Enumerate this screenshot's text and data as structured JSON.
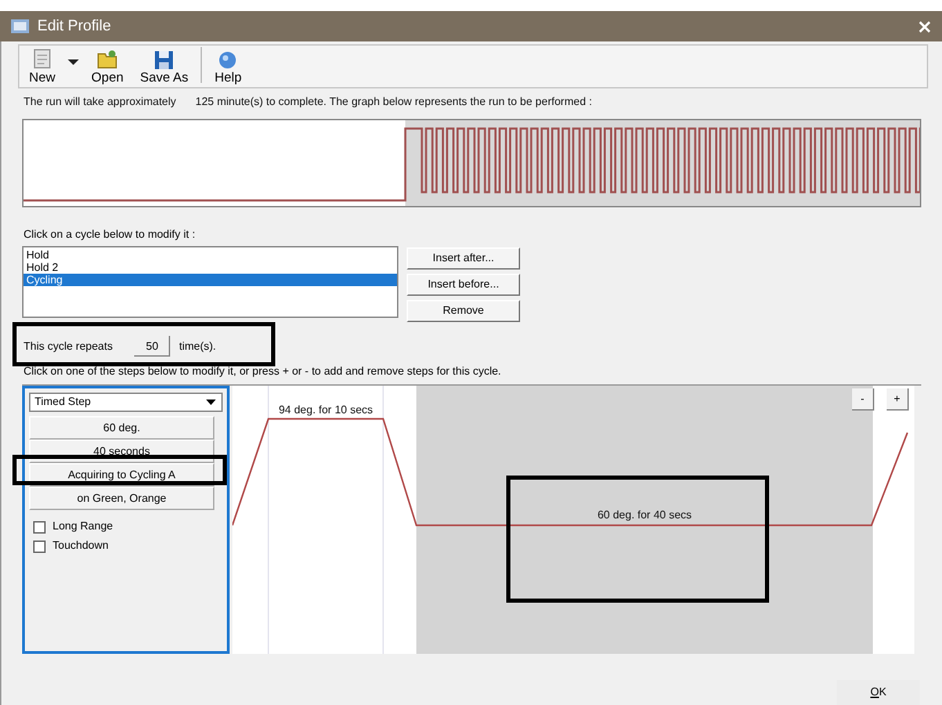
{
  "window": {
    "title": "Edit Profile"
  },
  "toolbar": [
    {
      "kind": "new",
      "label": "New"
    },
    {
      "kind": "dropdown"
    },
    {
      "kind": "open",
      "label": "Open"
    },
    {
      "kind": "save",
      "label": "Save As"
    },
    {
      "kind": "separator"
    },
    {
      "kind": "help",
      "label": "Help"
    }
  ],
  "run_info": {
    "prefix": "The run will take approximately",
    "duration": "125 minute(s) to complete. The graph below represents the run to be performed :"
  },
  "cycles_label": "Click on a cycle below to modify it :",
  "cycles": [
    {
      "label": "Hold",
      "selected": false
    },
    {
      "label": "Hold 2",
      "selected": false
    },
    {
      "label": "Cycling",
      "selected": true
    }
  ],
  "cycle_buttons": [
    "Insert after...",
    "Insert before...",
    "Remove"
  ],
  "repeat": {
    "label": "This cycle repeats",
    "value": "50",
    "unit": "time(s)."
  },
  "steps_label": "Click on one of the steps below to modify it, or press + or - to add and remove steps for this cycle.",
  "step_editor": {
    "type": "Timed Step",
    "buttons": [
      "60 deg.",
      "40 seconds",
      "Acquiring to Cycling A",
      "on Green, Orange"
    ],
    "options": [
      {
        "label": "Long Range",
        "checked": false
      },
      {
        "label": "Touchdown",
        "checked": false
      }
    ]
  },
  "steps": [
    {
      "label": "94 deg. for 10 secs",
      "selected": false
    },
    {
      "label": "60 deg. for 40 secs",
      "selected": true
    }
  ],
  "step_buttons": [
    "-",
    "+"
  ],
  "ok_button": "OK"
}
